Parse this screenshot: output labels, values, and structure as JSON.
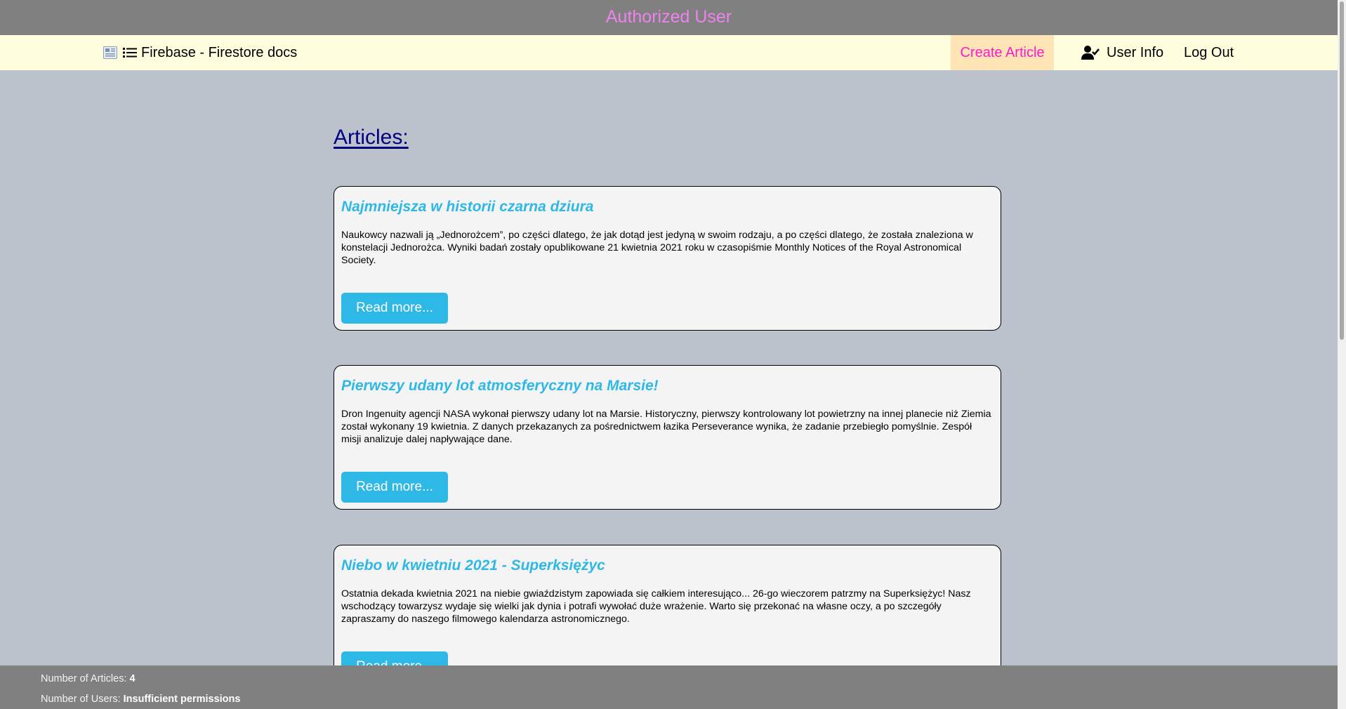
{
  "banner": {
    "text": "Authorized User"
  },
  "navbar": {
    "brand": "Firebase - Firestore docs",
    "create_article": "Create Article",
    "user_info": "User Info",
    "log_out": "Log Out",
    "icons": [
      "newspaper-icon",
      "list-icon",
      "user-check-icon"
    ]
  },
  "main": {
    "heading": "Articles:",
    "articles": [
      {
        "title": "Najmniejsza w historii czarna dziura",
        "description": "Naukowcy nazwali ją „Jednorożcem”, po części dlatego, że jak dotąd jest jedyną w swoim rodzaju, a po części dlatego, że została znaleziona w konstelacji Jednorożca. Wyniki badań zostały opublikowane 21 kwietnia 2021 roku w czasopiśmie Monthly Notices of the Royal Astronomical Society.",
        "button": "Read more..."
      },
      {
        "title": "Pierwszy udany lot atmosferyczny na Marsie!",
        "description": "Dron Ingenuity agencji NASA wykonał pierwszy udany lot na Marsie. Historyczny, pierwszy kontrolowany lot powietrzny na innej planecie niż Ziemia został wykonany 19 kwietnia. Z danych przekazanych za pośrednictwem łazika Perseverance wynika, że zadanie przebiegło pomyślnie. Zespół misji analizuje dalej napływające dane.",
        "button": "Read more..."
      },
      {
        "title": "Niebo w kwietniu 2021 - Superksiężyc",
        "description": "Ostatnia dekada kwietnia 2021 na niebie gwiaździstym zapowiada się całkiem interesująco... 26-go wieczorem patrzmy na Superksiężyc! Nasz wschodzący towarzysz wydaje się wielki jak dynia i potrafi wywołać duże wrażenie. Warto się przekonać na własne oczy, a po szczegóły zapraszamy do naszego filmowego kalendarza astronomicznego.",
        "button": "Read more..."
      }
    ]
  },
  "footer": {
    "articles_label": "Number of Articles: ",
    "articles_value": "4",
    "users_label": "Number of Users: ",
    "users_value": "Insufficient permissions"
  },
  "colors": {
    "page_bg": "#bbc2cc",
    "banner_bg": "#808080",
    "banner_text": "#ee82ee",
    "navbar_bg": "#ffffe0",
    "create_bg": "#ffe4b5",
    "create_text": "#ff1acb",
    "heading": "#000080",
    "accent": "#2eb8e6",
    "card_bg": "#f4f4f4"
  }
}
